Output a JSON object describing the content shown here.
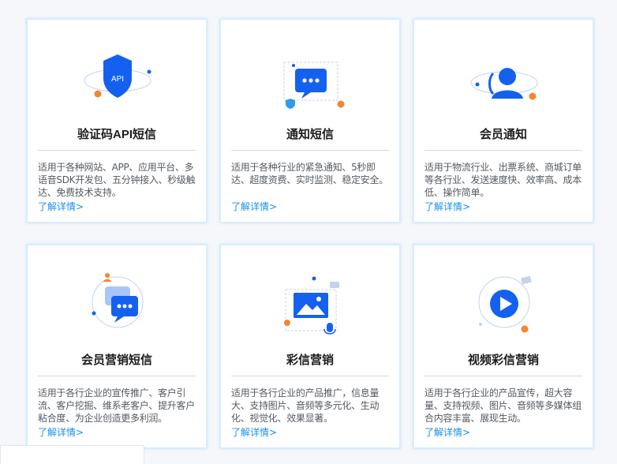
{
  "colors": {
    "accent_blue": "#1461f0",
    "link_blue": "#1a8fe8",
    "orange": "#f5862e",
    "title": "#1d1d1d",
    "text": "#555a60"
  },
  "cards": [
    {
      "icon": "shield-api-icon",
      "icon_label": "API",
      "title": "验证码API短信",
      "desc": "适用于各种网站、APP、应用平台、多语音SDK开发包、五分钟接入、秒级触达、免费技术支持。",
      "link": "了解详情>"
    },
    {
      "icon": "chat-bubble-icon",
      "title": "通知短信",
      "desc": "适用于各种行业的紧急通知、5秒即达、超度资费、实时监测、稳定安全。",
      "link": "了解详情>"
    },
    {
      "icon": "member-user-icon",
      "title": "会员通知",
      "desc": "适用于物流行业、出票系统、商城订单等各行业、发送速度快、效率高、成本低、操作简单。",
      "link": "了解详情>"
    },
    {
      "icon": "marketing-chat-icon",
      "title": "会员营销短信",
      "desc": "适用于各行企业的宣传推广、客户引流、客户挖掘、维系老客户、提升客户粘合度、为企业创造更多利润。",
      "link": "了解详情>"
    },
    {
      "icon": "image-message-icon",
      "title": "彩信营销",
      "desc": "适用于各行企业的产品推广，信息量大、支持图片、音频等多元化、生动化、视觉化、效果显著。",
      "link": "了解详情>"
    },
    {
      "icon": "video-play-icon",
      "title": "视频彩信营销",
      "desc": "适用于各行企业的产品宣传，超大容量、支持视频、图片、音频等多媒体组合内容丰富、展现生动。",
      "link": "了解详情>"
    }
  ]
}
